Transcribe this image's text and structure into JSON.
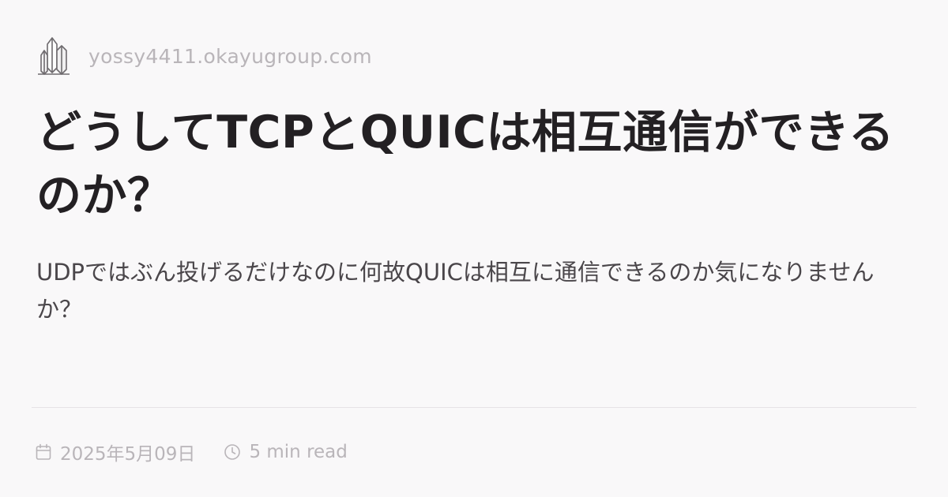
{
  "site": {
    "logo_icon": "crystal-icon",
    "name": "yossy4411.okayugroup.com"
  },
  "post": {
    "title": "どうしてTCPとQUICは相互通信ができるのか？",
    "description": "UDPではぶん投げるだけなのに何故QUICは相互に通信できるのか気になりませんか？"
  },
  "meta": {
    "date_icon": "calendar-icon",
    "date": "2025年5月09日",
    "reading_icon": "clock-icon",
    "reading_time": "5 min read"
  },
  "colors": {
    "background": "#f9f8f9",
    "title": "#232023",
    "muted": "#b9b5b9"
  }
}
